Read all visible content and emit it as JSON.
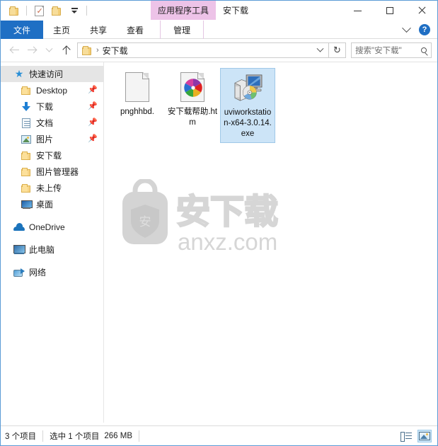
{
  "window": {
    "title": "安下载",
    "contextual_tab_header": "应用程序工具",
    "controls": {
      "minimize": "minimize-button",
      "maximize": "maximize-button",
      "close": "close-button"
    }
  },
  "quick_access_toolbar": {
    "items": [
      {
        "name": "folder-icon",
        "label": "属性文件夹"
      },
      {
        "name": "properties-icon",
        "label": "属性"
      },
      {
        "name": "new-folder-icon",
        "label": "新建文件夹"
      },
      {
        "name": "customize-caret",
        "label": "自定义快速访问工具栏"
      }
    ]
  },
  "ribbon": {
    "tabs": [
      {
        "label": "文件",
        "active": true,
        "kind": "file"
      },
      {
        "label": "主页",
        "active": false,
        "kind": "normal"
      },
      {
        "label": "共享",
        "active": false,
        "kind": "normal"
      },
      {
        "label": "查看",
        "active": false,
        "kind": "normal"
      },
      {
        "label": "管理",
        "active": false,
        "kind": "contextual"
      }
    ],
    "collapse_label": "展开功能区",
    "help_label": "?"
  },
  "addressbar": {
    "back_label": "后退",
    "forward_label": "前进",
    "recent_label": "最近浏览的位置",
    "up_label": "上移到",
    "breadcrumb": [
      "安下载"
    ],
    "crumb_separator": "›",
    "refresh_label": "↻",
    "dropdown_label": "历史记录"
  },
  "search": {
    "placeholder": "搜索\"安下载\"",
    "value": ""
  },
  "navpane": {
    "items": [
      {
        "label": "快速访问",
        "icon": "star-icon",
        "selected": true,
        "indent": false,
        "pinned": false
      },
      {
        "label": "Desktop",
        "icon": "folder-icon",
        "selected": false,
        "indent": true,
        "pinned": true
      },
      {
        "label": "下载",
        "icon": "download-icon",
        "selected": false,
        "indent": true,
        "pinned": true
      },
      {
        "label": "文档",
        "icon": "document-icon",
        "selected": false,
        "indent": true,
        "pinned": true
      },
      {
        "label": "图片",
        "icon": "pictures-icon",
        "selected": false,
        "indent": true,
        "pinned": true
      },
      {
        "label": "安下载",
        "icon": "folder-icon",
        "selected": false,
        "indent": true,
        "pinned": false
      },
      {
        "label": "图片管理器",
        "icon": "folder-icon",
        "selected": false,
        "indent": true,
        "pinned": false
      },
      {
        "label": "未上传",
        "icon": "folder-icon",
        "selected": false,
        "indent": true,
        "pinned": false
      },
      {
        "label": "桌面",
        "icon": "desktop-icon",
        "selected": false,
        "indent": true,
        "pinned": false
      },
      {
        "label": "OneDrive",
        "icon": "onedrive-cloud-icon",
        "selected": false,
        "indent": false,
        "pinned": false
      },
      {
        "label": "此电脑",
        "icon": "this-pc-icon",
        "selected": false,
        "indent": false,
        "pinned": false
      },
      {
        "label": "网络",
        "icon": "network-icon",
        "selected": false,
        "indent": false,
        "pinned": false
      }
    ],
    "pin_glyph": "📌"
  },
  "files": [
    {
      "name": "pnghhbd.",
      "icon": "blank-page-icon",
      "selected": false
    },
    {
      "name": "安下载帮助.htm",
      "icon": "html-pinwheel-icon",
      "selected": false
    },
    {
      "name": "uviworkstation-x64-3.0.14.exe",
      "icon": "setup-exe-icon",
      "selected": true
    }
  ],
  "watermark": {
    "brand_cn": "安下载",
    "brand_domain": "anxz.com",
    "shield_char": "安",
    "color": "#d2d2d2"
  },
  "statusbar": {
    "item_count": "3 个项目",
    "selection": "选中 1 个项目",
    "size": "266 MB",
    "views": [
      {
        "name": "details-view-button",
        "label": "详细信息",
        "active": false
      },
      {
        "name": "large-icons-view-button",
        "label": "大图标",
        "active": true
      }
    ]
  },
  "colors": {
    "accent": "#1f6fc4",
    "contextual_tab": "#edc3e8",
    "selection": "#cce4f7",
    "window_border": "#5b9bd5"
  }
}
